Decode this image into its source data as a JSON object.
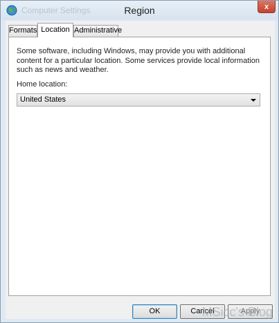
{
  "window": {
    "title": "Region",
    "background_title": "Computer Settings",
    "close_label": "x"
  },
  "tabs": [
    {
      "label": "Formats",
      "active": false
    },
    {
      "label": "Location",
      "active": true
    },
    {
      "label": "Administrative",
      "active": false
    }
  ],
  "location": {
    "description": "Some software, including Windows, may provide you with additional content for a particular location. Some services provide local information such as news and weather.",
    "home_label": "Home location:",
    "home_value": "United States"
  },
  "buttons": {
    "ok": "OK",
    "cancel": "Cancel",
    "apply": "Apply"
  },
  "watermark": "MSicc's Blog",
  "colors": {
    "close_button": "#c6422c",
    "window_frame": "#dfe9f3",
    "default_button_border": "#3c7fb1"
  }
}
